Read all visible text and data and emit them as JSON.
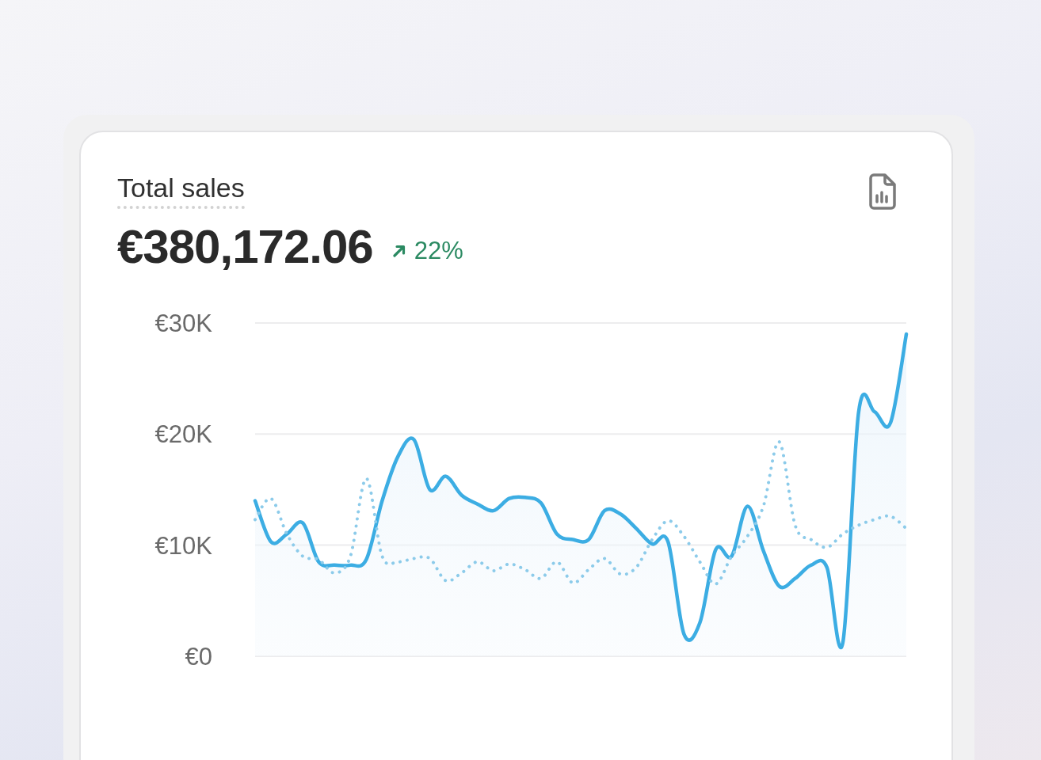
{
  "card": {
    "title": "Total sales",
    "total": "€380,172.06",
    "change": "22%",
    "chart_data": {
      "type": "line",
      "grid": true,
      "ylim": [
        0,
        30000
      ],
      "yticks": [
        {
          "value": 30000,
          "label": "€30K"
        },
        {
          "value": 20000,
          "label": "€20K"
        },
        {
          "value": 10000,
          "label": "€10K"
        },
        {
          "value": 0,
          "label": "€0"
        }
      ],
      "series": [
        {
          "type": "area",
          "color": "#3cade3",
          "line_style": "solid",
          "values": [
            14000,
            10300,
            11000,
            12000,
            8500,
            8200,
            8200,
            8700,
            14000,
            18000,
            19500,
            15000,
            16200,
            14500,
            13700,
            13100,
            14200,
            14300,
            13800,
            11000,
            10500,
            10500,
            13100,
            12800,
            11500,
            10100,
            10300,
            2000,
            3000,
            9600,
            9000,
            13500,
            9500,
            6300,
            7000,
            8200,
            8000,
            1200,
            22000,
            22000,
            21000,
            29000
          ]
        },
        {
          "type": "line",
          "color": "#8ccbea",
          "line_style": "dotted",
          "values": [
            12300,
            14200,
            11000,
            9000,
            8700,
            7500,
            9000,
            16000,
            9000,
            8500,
            8800,
            8800,
            6800,
            7500,
            8500,
            7700,
            8300,
            7800,
            7000,
            8500,
            6600,
            7800,
            8800,
            7400,
            8000,
            10500,
            12200,
            10800,
            8500,
            6500,
            9000,
            10800,
            13500,
            19300,
            11800,
            10500,
            9800,
            11000,
            11800,
            12300,
            12600,
            11500
          ]
        }
      ]
    }
  }
}
